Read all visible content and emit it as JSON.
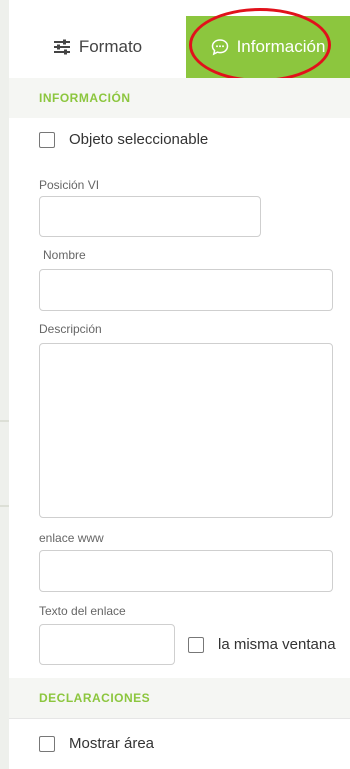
{
  "tabs": {
    "format_label": "Formato",
    "info_label": "Información"
  },
  "info_section": {
    "title": "INFORMACIÓN",
    "selectable_label": "Objeto seleccionable",
    "position_label": "Posición VI",
    "name_label": "Nombre",
    "description_label": "Descripción",
    "link_label": "enlace www",
    "link_text_label": "Texto del enlace",
    "same_window_label": "la misma ventana"
  },
  "declarations_section": {
    "title": "DECLARACIONES",
    "show_area_label": "Mostrar área"
  },
  "colors": {
    "accent": "#8cc63e",
    "highlight": "#e1111b"
  }
}
